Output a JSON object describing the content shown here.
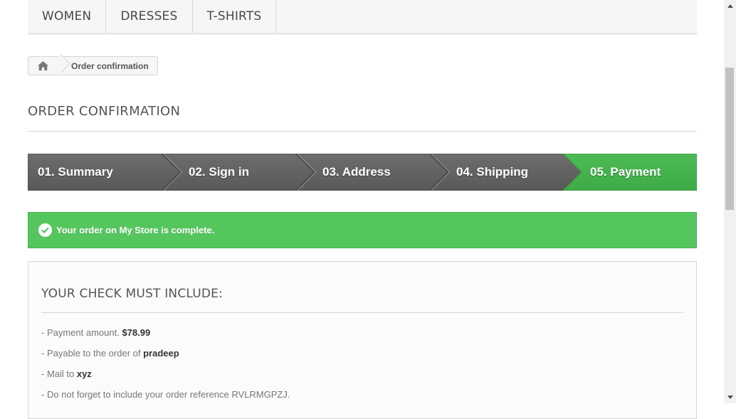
{
  "nav": {
    "items": [
      {
        "label": "WOMEN"
      },
      {
        "label": "DRESSES"
      },
      {
        "label": "T-SHIRTS"
      }
    ]
  },
  "breadcrumb": {
    "home_icon": "home-icon",
    "current": "Order confirmation"
  },
  "page_title": "ORDER CONFIRMATION",
  "steps": [
    {
      "label": "01. Summary"
    },
    {
      "label": "02. Sign in"
    },
    {
      "label": "03. Address"
    },
    {
      "label": "04. Shipping"
    },
    {
      "label": "05. Payment",
      "active": true
    }
  ],
  "colors": {
    "step_inactive": "#666666",
    "step_active": "#46b44f",
    "alert_success": "#55c65e"
  },
  "alert": {
    "icon": "check-circle-icon",
    "message": "Your order on My Store is complete."
  },
  "check_box": {
    "title": "YOUR CHECK MUST INCLUDE:",
    "lines": [
      {
        "prefix": "- Payment amount. ",
        "value": "$78.99"
      },
      {
        "prefix": "- Payable to the order of ",
        "value": "pradeep"
      },
      {
        "prefix": "- Mail to ",
        "value": "xyz"
      },
      {
        "prefix": "- Do not forget to include your order reference RVLRMGPZJ."
      }
    ]
  }
}
